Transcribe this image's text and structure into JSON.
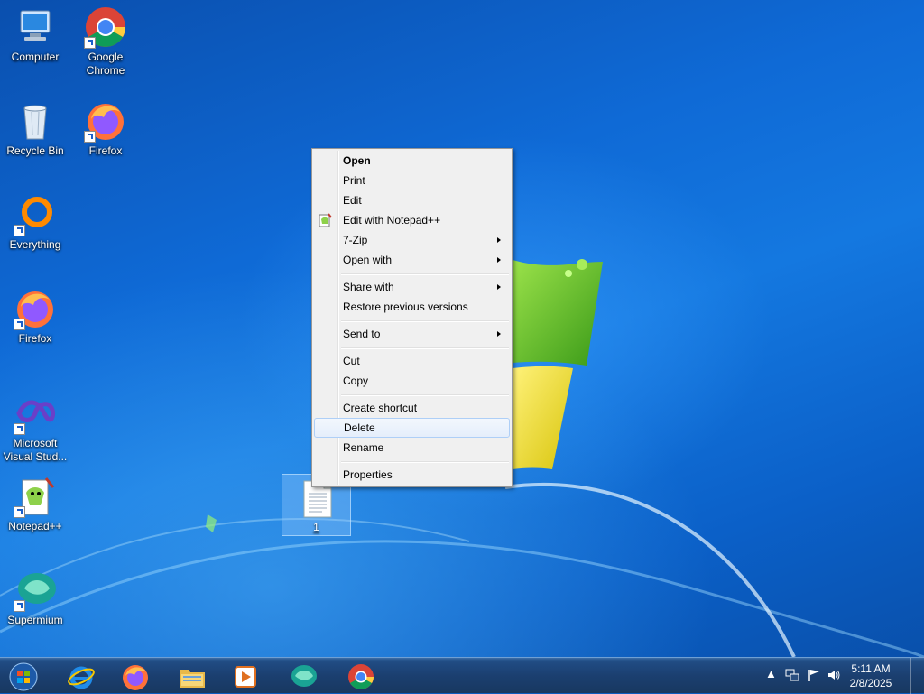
{
  "desktop_icons": [
    {
      "name": "desktop-icon-computer",
      "label": "Computer"
    },
    {
      "name": "desktop-icon-google-chrome",
      "label": "Google Chrome"
    },
    {
      "name": "desktop-icon-recycle-bin",
      "label": "Recycle Bin"
    },
    {
      "name": "desktop-icon-firefox-top",
      "label": "Firefox"
    },
    {
      "name": "desktop-icon-everything",
      "label": "Everything"
    },
    {
      "name": "desktop-icon-firefox",
      "label": "Firefox"
    },
    {
      "name": "desktop-icon-visual-studio",
      "label": "Microsoft Visual Stud..."
    },
    {
      "name": "desktop-icon-notepadpp",
      "label": "Notepad++"
    },
    {
      "name": "desktop-icon-supermium",
      "label": "Supermium"
    }
  ],
  "selected_file": {
    "label": "1"
  },
  "context_menu": {
    "items": [
      {
        "label": "Open",
        "bold": true
      },
      {
        "label": "Print"
      },
      {
        "label": "Edit"
      },
      {
        "label": "Edit with Notepad++",
        "icon": "notepadpp-icon"
      },
      {
        "label": "7-Zip",
        "submenu": true
      },
      {
        "label": "Open with",
        "submenu": true
      },
      {
        "label": "Share with",
        "submenu": true
      },
      {
        "label": "Restore previous versions"
      },
      {
        "label": "Send to",
        "submenu": true
      },
      {
        "label": "Cut"
      },
      {
        "label": "Copy"
      },
      {
        "label": "Create shortcut"
      },
      {
        "label": "Delete",
        "highlighted": true
      },
      {
        "label": "Rename"
      },
      {
        "label": "Properties"
      }
    ]
  },
  "taskbar": {
    "pinned": [
      "start-orb",
      "internet-explorer-icon",
      "firefox-icon",
      "file-explorer-icon",
      "media-player-icon",
      "supermium-icon",
      "chrome-icon"
    ],
    "clock": {
      "time": "5:11 AM",
      "date": "2/8/2025"
    }
  },
  "colors": {
    "accent": "#1478e0",
    "menu_highlight": "#aecff7"
  }
}
